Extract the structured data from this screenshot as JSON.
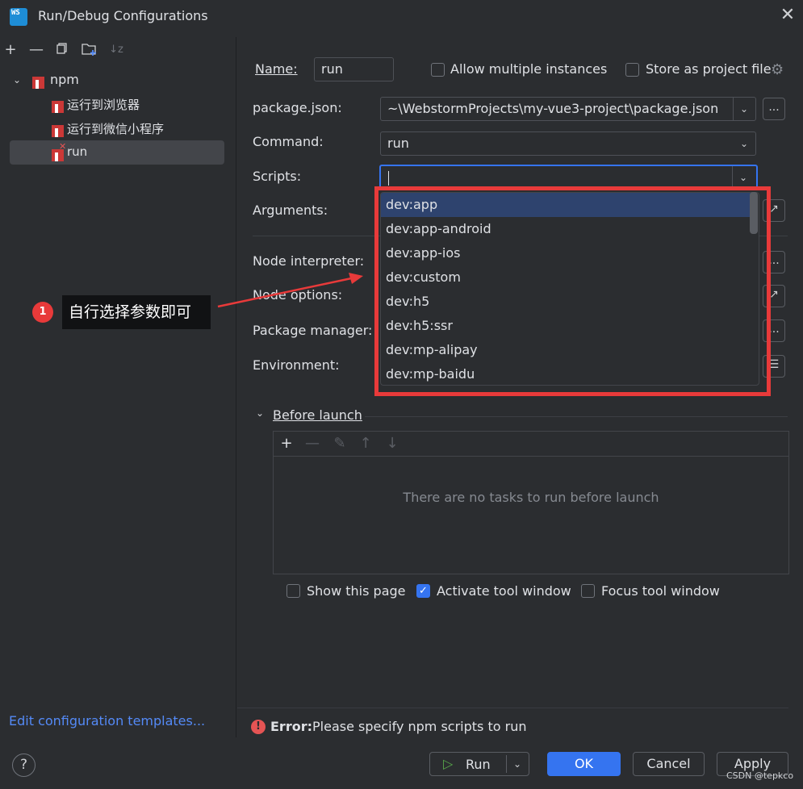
{
  "window": {
    "title": "Run/Debug Configurations",
    "app_icon_text": "WS"
  },
  "toolbar": {
    "icons": [
      "add-icon",
      "remove-icon",
      "copy-icon",
      "new-folder-icon",
      "sort-icon"
    ]
  },
  "tree": {
    "root": "npm",
    "items": [
      "运行到浏览器",
      "运行到微信小程序",
      "run"
    ]
  },
  "left": {
    "edit_templates": "Edit configuration templates..."
  },
  "form": {
    "name_label": "Name:",
    "name_value": "run",
    "allow_multiple": "Allow multiple instances",
    "store_project": "Store as project file",
    "package_json_label": "package.json:",
    "package_json_value": "~\\WebstormProjects\\my-vue3-project\\package.json",
    "command_label": "Command:",
    "command_value": "run",
    "scripts_label": "Scripts:",
    "scripts_value": "",
    "arguments_label": "Arguments:",
    "node_interpreter_label": "Node interpreter:",
    "node_options_label": "Node options:",
    "package_manager_label": "Package manager:",
    "environment_label": "Environment:",
    "browse": "..."
  },
  "dropdown": {
    "items": [
      "dev:app",
      "dev:app-android",
      "dev:app-ios",
      "dev:custom",
      "dev:h5",
      "dev:h5:ssr",
      "dev:mp-alipay",
      "dev:mp-baidu"
    ],
    "selected": "dev:app"
  },
  "callout": {
    "number": "1",
    "text": "自行选择参数即可"
  },
  "before_launch": {
    "title": "Before launch",
    "empty": "There are no tasks to run before launch",
    "show_page": "Show this page",
    "activate_tool": "Activate tool window",
    "focus_tool": "Focus tool window"
  },
  "status": {
    "error_label": "Error:",
    "error_text": "Please specify npm scripts to run"
  },
  "buttons": {
    "run": "Run",
    "ok": "OK",
    "cancel": "Cancel",
    "apply": "Apply"
  },
  "help": "?",
  "watermark": "CSDN @tepkco",
  "colors": {
    "accent": "#3574f0",
    "highlight": "#e83a3a",
    "npm": "#cb3837",
    "link": "#548af7"
  }
}
